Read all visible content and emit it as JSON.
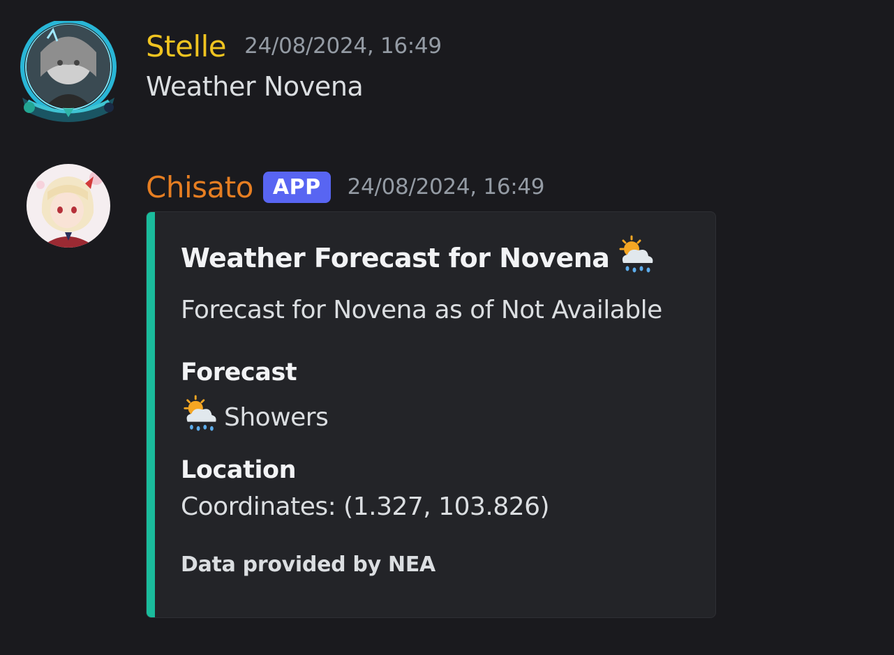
{
  "messages": [
    {
      "username": "Stelle",
      "username_color": "#f0c420",
      "timestamp": "24/08/2024, 16:49",
      "avatar_icon": "user-avatar-icon",
      "content": "Weather Novena"
    },
    {
      "username": "Chisato",
      "username_color": "#e67e22",
      "badge": "APP",
      "timestamp": "24/08/2024, 16:49",
      "avatar_icon": "bot-avatar-icon",
      "embed": {
        "accent_color": "#1abc9c",
        "title": "Weather Forecast for Novena",
        "title_icon": "sun-behind-rain-cloud-icon",
        "description": "Forecast for Novena as of Not Available",
        "fields": [
          {
            "name": "Forecast",
            "value": "Showers",
            "value_icon": "sun-behind-rain-cloud-icon"
          },
          {
            "name": "Location",
            "value": "Coordinates: (1.327, 103.826)"
          }
        ],
        "footer": "Data provided by NEA"
      }
    }
  ]
}
